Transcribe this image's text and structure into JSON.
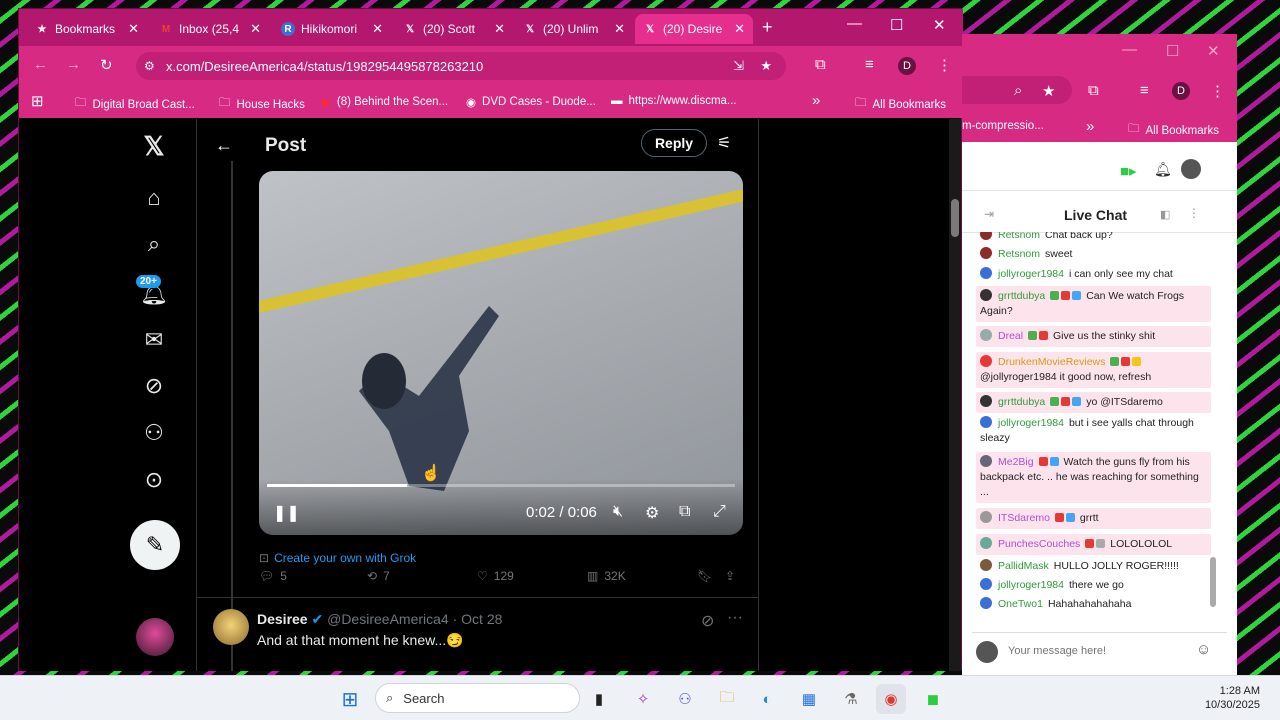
{
  "browser": {
    "tabs": [
      {
        "label": "Bookmarks",
        "icon": "star-icon"
      },
      {
        "label": "Inbox (25,4",
        "icon": "gmail-icon"
      },
      {
        "label": "Hikikomori",
        "icon": "r-icon"
      },
      {
        "label": "(20) Scott",
        "icon": "x-logo-icon"
      },
      {
        "label": "(20) Unlim",
        "icon": "x-logo-icon"
      },
      {
        "label": "(20) Desire",
        "icon": "x-logo-icon"
      }
    ],
    "url": "x.com/DesireeAmerica4/status/1982954495878263210",
    "profile_initial": "D",
    "bookmarks": [
      "Digital Broad Cast...",
      "House Hacks",
      "(8) Behind the Scen...",
      "DVD Cases - Duode...",
      "https://www.discma..."
    ],
    "all_bookmarks": "All Bookmarks"
  },
  "x": {
    "header_title": "Post",
    "reply_button": "Reply",
    "notif_badge": "20+",
    "video": {
      "time": "0:02 / 0:06",
      "progress": 0.3
    },
    "grok_link": "Create your own with Grok",
    "stats": {
      "replies": "5",
      "reposts": "7",
      "likes": "129",
      "views": "32K"
    },
    "next_post": {
      "name": "Desiree",
      "handle": "@DesireeAmerica4",
      "date": "· Oct 28",
      "text": "And at that moment he knew...😏"
    }
  },
  "chat_window": {
    "bookmark_partial": "m-compressio...",
    "all_bookmarks": "All Bookmarks",
    "profile_initial": "D",
    "title": "Live Chat",
    "messages": [
      {
        "user": "Retsnom",
        "text": "Chat back up?",
        "color": "#2e9d3a"
      },
      {
        "user": "Retsnom",
        "text": "sweet",
        "color": "#2e9d3a"
      },
      {
        "user": "jollyroger1984",
        "text": "i can only see my chat",
        "color": "#2e9d3a"
      },
      {
        "user": "grrttdubya",
        "text": "Can We watch Frogs Again?",
        "color": "#2e9d3a"
      },
      {
        "user": "Dreal",
        "text": "Give us the stinky shit",
        "color": "#b04fd6"
      },
      {
        "user": "DrunkenMovieReviews",
        "text": "@jollyroger1984 it good now, refresh",
        "color": "#d89c12"
      },
      {
        "user": "grrttdubya",
        "text": "yo @ITSdaremo",
        "color": "#2e9d3a"
      },
      {
        "user": "jollyroger1984",
        "text": "but i see yalls chat through sleazy",
        "color": "#2e9d3a"
      },
      {
        "user": "Me2Big",
        "text": "Watch the guns fly from his backpack etc. .. he was reaching for something ...",
        "color": "#b04fd6"
      },
      {
        "user": "ITSdaremo",
        "text": "grrtt",
        "color": "#b04fd6"
      },
      {
        "user": "PunchesCouches",
        "text": "LOLOLOLOL",
        "color": "#b04fd6"
      },
      {
        "user": "PallidMask",
        "text": "HULLO JOLLY ROGER!!!!!",
        "color": "#2e9d3a"
      },
      {
        "user": "jollyroger1984",
        "text": "there we go",
        "color": "#2e9d3a"
      },
      {
        "user": "OneTwo1",
        "text": "Hahahahahahaha",
        "color": "#2e9d3a"
      }
    ],
    "input_placeholder": "Your message here!"
  },
  "taskbar": {
    "search_placeholder": "Search",
    "time": "1:28 AM",
    "date": "10/30/2025"
  }
}
